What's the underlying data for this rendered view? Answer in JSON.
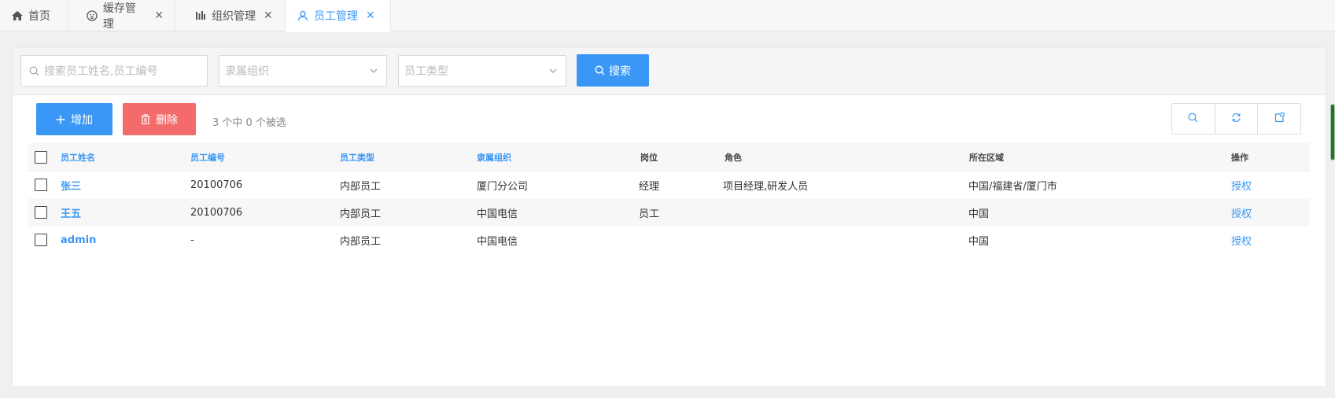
{
  "tabs": [
    {
      "label": "首页",
      "icon": "home-icon"
    },
    {
      "label": "缓存管理",
      "icon": "cache-icon"
    },
    {
      "label": "组织管理",
      "icon": "org-icon"
    },
    {
      "label": "员工管理",
      "icon": "user-icon"
    }
  ],
  "filters": {
    "search_placeholder": "搜索员工姓名,员工编号",
    "org_placeholder": "隶属组织",
    "type_placeholder": "员工类型",
    "search_button": "搜索"
  },
  "toolbar": {
    "add_label": "增加",
    "delete_label": "删除",
    "selection_status": "3 个中 0 个被选"
  },
  "table": {
    "headers": {
      "name": "员工姓名",
      "code": "员工编号",
      "type": "员工类型",
      "org": "隶属组织",
      "post": "岗位",
      "role": "角色",
      "region": "所在区域",
      "action": "操作"
    },
    "rows": [
      {
        "name": "张三",
        "code": "20100706",
        "type": "内部员工",
        "org": "厦门分公司",
        "post": "经理",
        "role": "项目经理,研发人员",
        "region": "中国/福建省/厦门市",
        "action": "授权"
      },
      {
        "name": "王五",
        "code": "20100706",
        "type": "内部员工",
        "org": "中国电信",
        "post": "员工",
        "role": "",
        "region": "中国",
        "action": "授权"
      },
      {
        "name": "admin",
        "code": "-",
        "type": "内部员工",
        "org": "中国电信",
        "post": "",
        "role": "",
        "region": "中国",
        "action": "授权"
      }
    ]
  },
  "colors": {
    "accent": "#3a97f5",
    "danger": "#f46b6b"
  }
}
